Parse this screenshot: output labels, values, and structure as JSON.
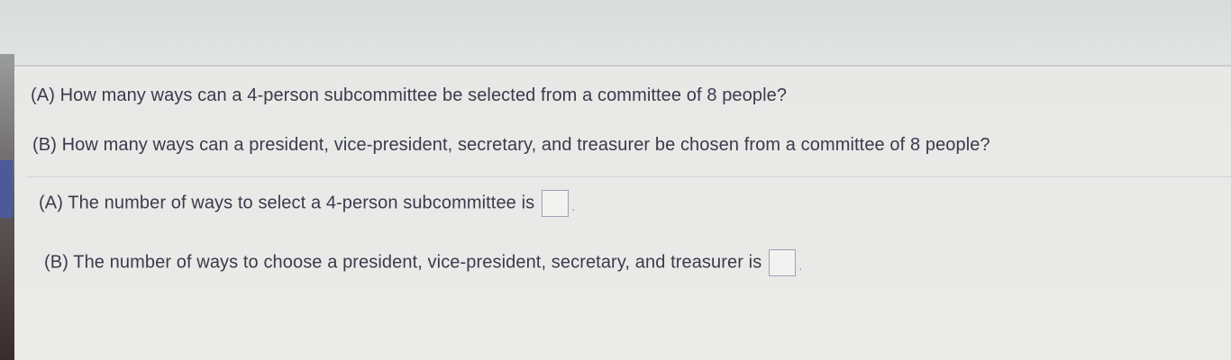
{
  "questions": {
    "a": "(A) How many ways can a 4-person subcommittee be selected from a committee of 8 people?",
    "b": "(B) How many ways can a president, vice-president, secretary, and treasurer be chosen from a committee of 8 people?"
  },
  "answers": {
    "a_prompt": "(A) The number of ways to select a 4-person subcommittee is",
    "a_value": "",
    "b_prompt": "(B) The number of ways to choose a president, vice-president, secretary, and treasurer is",
    "b_value": "",
    "end_punct": "."
  }
}
